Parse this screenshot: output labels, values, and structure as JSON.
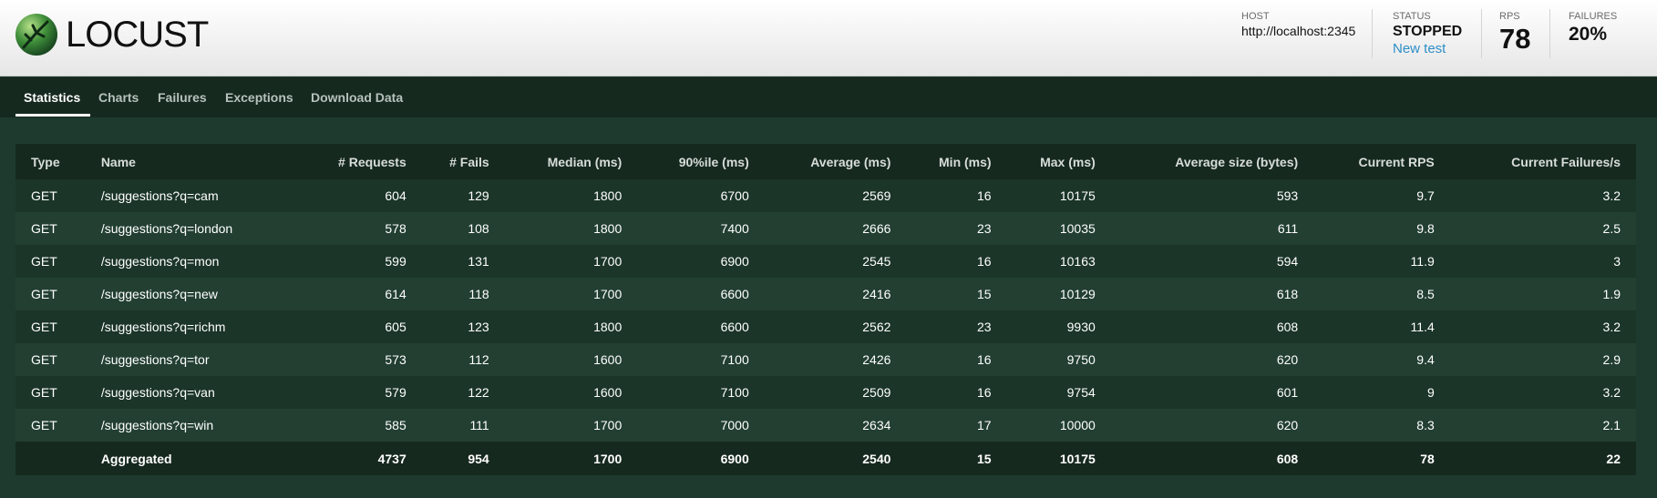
{
  "header": {
    "logo_text": "LOCUST",
    "host_label": "HOST",
    "host_value": "http://localhost:2345",
    "status_label": "STATUS",
    "status_value": "STOPPED",
    "new_test_link": "New test",
    "rps_label": "RPS",
    "rps_value": "78",
    "failures_label": "FAILURES",
    "failures_value": "20%"
  },
  "tabs": [
    {
      "label": "Statistics"
    },
    {
      "label": "Charts"
    },
    {
      "label": "Failures"
    },
    {
      "label": "Exceptions"
    },
    {
      "label": "Download Data"
    }
  ],
  "table": {
    "columns": [
      "Type",
      "Name",
      "# Requests",
      "# Fails",
      "Median (ms)",
      "90%ile (ms)",
      "Average (ms)",
      "Min (ms)",
      "Max (ms)",
      "Average size (bytes)",
      "Current RPS",
      "Current Failures/s"
    ],
    "rows": [
      [
        "GET",
        "/suggestions?q=cam",
        "604",
        "129",
        "1800",
        "6700",
        "2569",
        "16",
        "10175",
        "593",
        "9.7",
        "3.2"
      ],
      [
        "GET",
        "/suggestions?q=london",
        "578",
        "108",
        "1800",
        "7400",
        "2666",
        "23",
        "10035",
        "611",
        "9.8",
        "2.5"
      ],
      [
        "GET",
        "/suggestions?q=mon",
        "599",
        "131",
        "1700",
        "6900",
        "2545",
        "16",
        "10163",
        "594",
        "11.9",
        "3"
      ],
      [
        "GET",
        "/suggestions?q=new",
        "614",
        "118",
        "1700",
        "6600",
        "2416",
        "15",
        "10129",
        "618",
        "8.5",
        "1.9"
      ],
      [
        "GET",
        "/suggestions?q=richm",
        "605",
        "123",
        "1800",
        "6600",
        "2562",
        "23",
        "9930",
        "608",
        "11.4",
        "3.2"
      ],
      [
        "GET",
        "/suggestions?q=tor",
        "573",
        "112",
        "1600",
        "7100",
        "2426",
        "16",
        "9750",
        "620",
        "9.4",
        "2.9"
      ],
      [
        "GET",
        "/suggestions?q=van",
        "579",
        "122",
        "1600",
        "7100",
        "2509",
        "16",
        "9754",
        "601",
        "9",
        "3.2"
      ],
      [
        "GET",
        "/suggestions?q=win",
        "585",
        "111",
        "1700",
        "7000",
        "2634",
        "17",
        "10000",
        "620",
        "8.3",
        "2.1"
      ]
    ],
    "aggregate": [
      "",
      "Aggregated",
      "4737",
      "954",
      "1700",
      "6900",
      "2540",
      "15",
      "10175",
      "608",
      "78",
      "22"
    ]
  },
  "colors": {
    "background": "#1e3a2e",
    "nav": "#16291f",
    "link": "#2f8fc7"
  }
}
